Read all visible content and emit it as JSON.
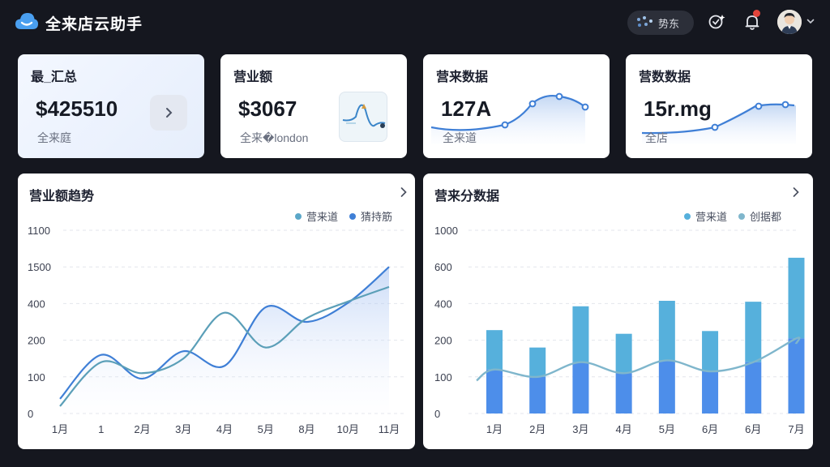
{
  "app": {
    "title": "全来店云助手"
  },
  "header": {
    "pill_label": "势东",
    "notification_badge": true
  },
  "stat_cards": [
    {
      "title": "最_汇总",
      "value": "$425510",
      "sub": "全来庭"
    },
    {
      "title": "营业额",
      "value": "$3067",
      "sub": "全来�london"
    },
    {
      "title": "营来数据",
      "value": "127A",
      "sub": "全来道"
    },
    {
      "title": "营数数据",
      "value": "15r.mg",
      "sub": "全店"
    }
  ],
  "panels": {
    "left": {
      "title": "营业额趋势",
      "legend": [
        "营来道",
        "猜持筋"
      ]
    },
    "right": {
      "title": "营来分数据",
      "legend": [
        "营来道",
        "创据都"
      ]
    }
  },
  "colors": {
    "accent": "#3f7fd6",
    "teal": "#5b9fb8",
    "bar_top": "#56b0dc",
    "bar_bottom": "#4d8eea",
    "line_light": "#7fb6cc"
  },
  "chart_data": [
    {
      "type": "line",
      "title": "营业额趋势",
      "y_tick_labels": [
        "1100",
        "1500",
        "400",
        "200",
        "100",
        "0"
      ],
      "x_tick_labels": [
        "1月",
        "1",
        "2月",
        "3月",
        "4月",
        "5月",
        "8月",
        "10月",
        "11月"
      ],
      "series": [
        {
          "name": "营来道",
          "values": [
            40,
            160,
            95,
            170,
            130,
            380,
            300,
            420,
            1500
          ]
        },
        {
          "name": "猜持筋",
          "values": [
            20,
            140,
            110,
            150,
            350,
            180,
            320,
            460,
            900
          ]
        }
      ],
      "grid": true
    },
    {
      "type": "bar",
      "title": "营来分数据",
      "y_tick_labels": [
        "1000",
        "600",
        "400",
        "200",
        "100",
        "0"
      ],
      "categories": [
        "1月",
        "2月",
        "3月",
        "4月",
        "5月",
        "6月",
        "6月",
        "7月"
      ],
      "series": [
        {
          "name": "营来道",
          "values": [
            255,
            180,
            385,
            235,
            415,
            250,
            410,
            700
          ]
        },
        {
          "name": "创据都",
          "values": [
            120,
            100,
            140,
            110,
            145,
            115,
            140,
            210
          ]
        }
      ],
      "grid": true
    }
  ]
}
